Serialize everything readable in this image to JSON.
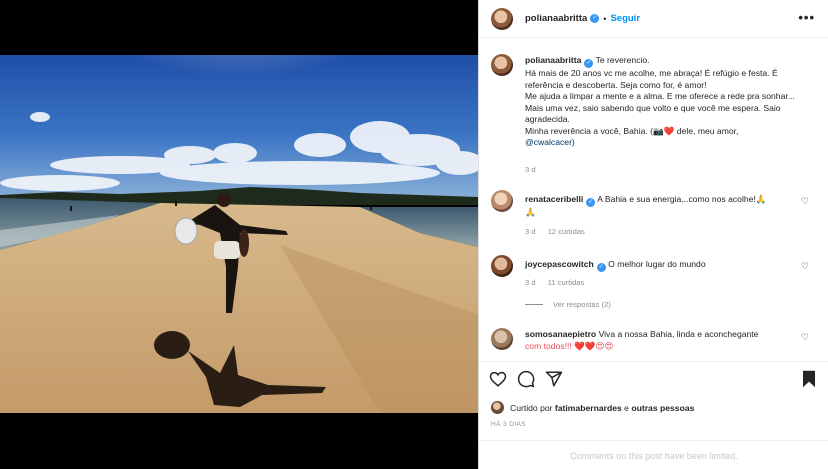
{
  "post": {
    "username": "polianaabritta",
    "follow_label": "Seguir",
    "more_label": "•••"
  },
  "caption": {
    "username": "polianaabritta",
    "lines": [
      "Te reverencio.",
      "Há mais de 20 anos vc me acolhe, me abraça! É refúgio e festa. É referência e descoberta. Seja como for, é amor!",
      "Me ajuda a limpar a mente e a alma. E me oferece a rede pra sonhar... Mais uma vez, saio sabendo que volto e que você me espera. Saio agradecida.",
      "Minha reverência a você, Bahia. (📷❤️ dele, meu amor,",
      "@cwalcacer)"
    ],
    "time": "3 d"
  },
  "comments": [
    {
      "username": "renataceribelli",
      "text": "A Bahia e sua energia...como nos acolhe!🙏",
      "text2": "🙏",
      "time": "3 d",
      "likes": "12 curtidas"
    },
    {
      "username": "joycepascowitch",
      "text": "O melhor lugar do mundo",
      "time": "3 d",
      "likes": "11 curtidas",
      "replies": "Ver respostas (2)"
    },
    {
      "username": "somosanaepietro",
      "text": "Viva a nossa Bahia, linda e aconchegante",
      "text2": "com todos!!! ❤️❤️😍😍"
    }
  ],
  "likes": {
    "prefix": "Curtido por",
    "user": "fatimabernardes",
    "connector": "e",
    "others": "outras pessoas"
  },
  "date": "HÁ 3 DIAS",
  "limited_notice": "Comments on this post have been limited."
}
